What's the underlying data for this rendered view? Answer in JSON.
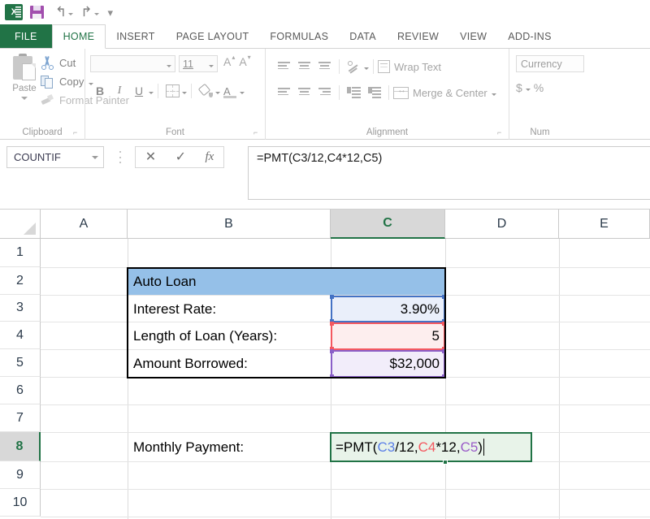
{
  "window": {
    "quick_access": {
      "app_icon": "excel-logo-icon",
      "app_icon_text": "X",
      "save": "save-icon",
      "undo": "undo-icon",
      "undo_glyph": "↰",
      "redo": "redo-icon",
      "redo_glyph": "↱",
      "customize": "customize-quick-access-icon",
      "customize_glyph": "▾"
    }
  },
  "ribbon": {
    "tabs": [
      {
        "label": "FILE",
        "active": false,
        "file": true
      },
      {
        "label": "HOME",
        "active": true,
        "file": false
      },
      {
        "label": "INSERT",
        "active": false,
        "file": false
      },
      {
        "label": "PAGE LAYOUT",
        "active": false,
        "file": false
      },
      {
        "label": "FORMULAS",
        "active": false,
        "file": false
      },
      {
        "label": "DATA",
        "active": false,
        "file": false
      },
      {
        "label": "REVIEW",
        "active": false,
        "file": false
      },
      {
        "label": "VIEW",
        "active": false,
        "file": false
      },
      {
        "label": "ADD-INS",
        "active": false,
        "file": false
      }
    ],
    "clipboard": {
      "group_label": "Clipboard",
      "paste_label": "Paste",
      "cut_label": "Cut",
      "copy_label": "Copy",
      "format_painter_label": "Format Painter",
      "launcher_glyph": "⌐"
    },
    "font": {
      "group_label": "Font",
      "font_name_value": "",
      "font_size_value": "11",
      "grow_font": "A",
      "shrink_font": "A",
      "bold_label": "B",
      "italic_label": "I",
      "underline_label": "U",
      "font_color_label": "A",
      "launcher_glyph": "⌐"
    },
    "alignment": {
      "group_label": "Alignment",
      "wrap_text_label": "Wrap Text",
      "merge_center_label": "Merge & Center",
      "launcher_glyph": "⌐"
    },
    "number": {
      "group_label": "Num",
      "format_value": "Currency",
      "accounting_symbol": "$",
      "percent_symbol": "%"
    }
  },
  "formula_bar": {
    "name_box_value": "COUNTIF",
    "cancel_glyph": "✕",
    "enter_glyph": "✓",
    "function_glyph": "fx",
    "formula_text": "=PMT(C3/12,C4*12,C5)"
  },
  "grid": {
    "columns": [
      "A",
      "B",
      "C",
      "D",
      "E"
    ],
    "active_column": "C",
    "rows": [
      "1",
      "2",
      "3",
      "4",
      "5",
      "6",
      "7",
      "8",
      "9",
      "10"
    ],
    "active_row": "8",
    "cells": [
      {
        "ref": "B2",
        "value": "Auto Loan",
        "align": "left"
      },
      {
        "ref": "B3",
        "value": "Interest Rate:",
        "align": "left"
      },
      {
        "ref": "C3",
        "value": "3.90%",
        "align": "right"
      },
      {
        "ref": "B4",
        "value": "Length of Loan (Years):",
        "align": "left"
      },
      {
        "ref": "C4",
        "value": "5",
        "align": "right"
      },
      {
        "ref": "B5",
        "value": "Amount Borrowed:",
        "align": "left"
      },
      {
        "ref": "C5",
        "value": "$32,000",
        "align": "right"
      },
      {
        "ref": "B8",
        "value": "Monthly Payment:",
        "align": "left"
      }
    ],
    "editing_cell": {
      "ref": "C8",
      "tokens": [
        {
          "text": "=PMT(",
          "color_role": "plain"
        },
        {
          "text": "C3",
          "color_role": "ref_blue"
        },
        {
          "text": "/12,",
          "color_role": "plain"
        },
        {
          "text": "C4",
          "color_role": "ref_red"
        },
        {
          "text": "*12,",
          "color_role": "plain"
        },
        {
          "text": "C5",
          "color_role": "ref_purple"
        },
        {
          "text": ")",
          "color_role": "plain"
        }
      ]
    },
    "reference_highlights": [
      {
        "ref": "C3",
        "border_color": "#4472c4",
        "fill_color": "#eaeffa"
      },
      {
        "ref": "C4",
        "border_color": "#f4585f",
        "fill_color": "#fdeeee"
      },
      {
        "ref": "C5",
        "border_color": "#8a5fc8",
        "fill_color": "#f2edfa"
      }
    ],
    "colors": {
      "banner_fill": "#95c0e8",
      "active_cell_border": "#217346",
      "active_cell_fill": "#e8f3e9",
      "header_active_bg": "#d8d8d8"
    }
  }
}
